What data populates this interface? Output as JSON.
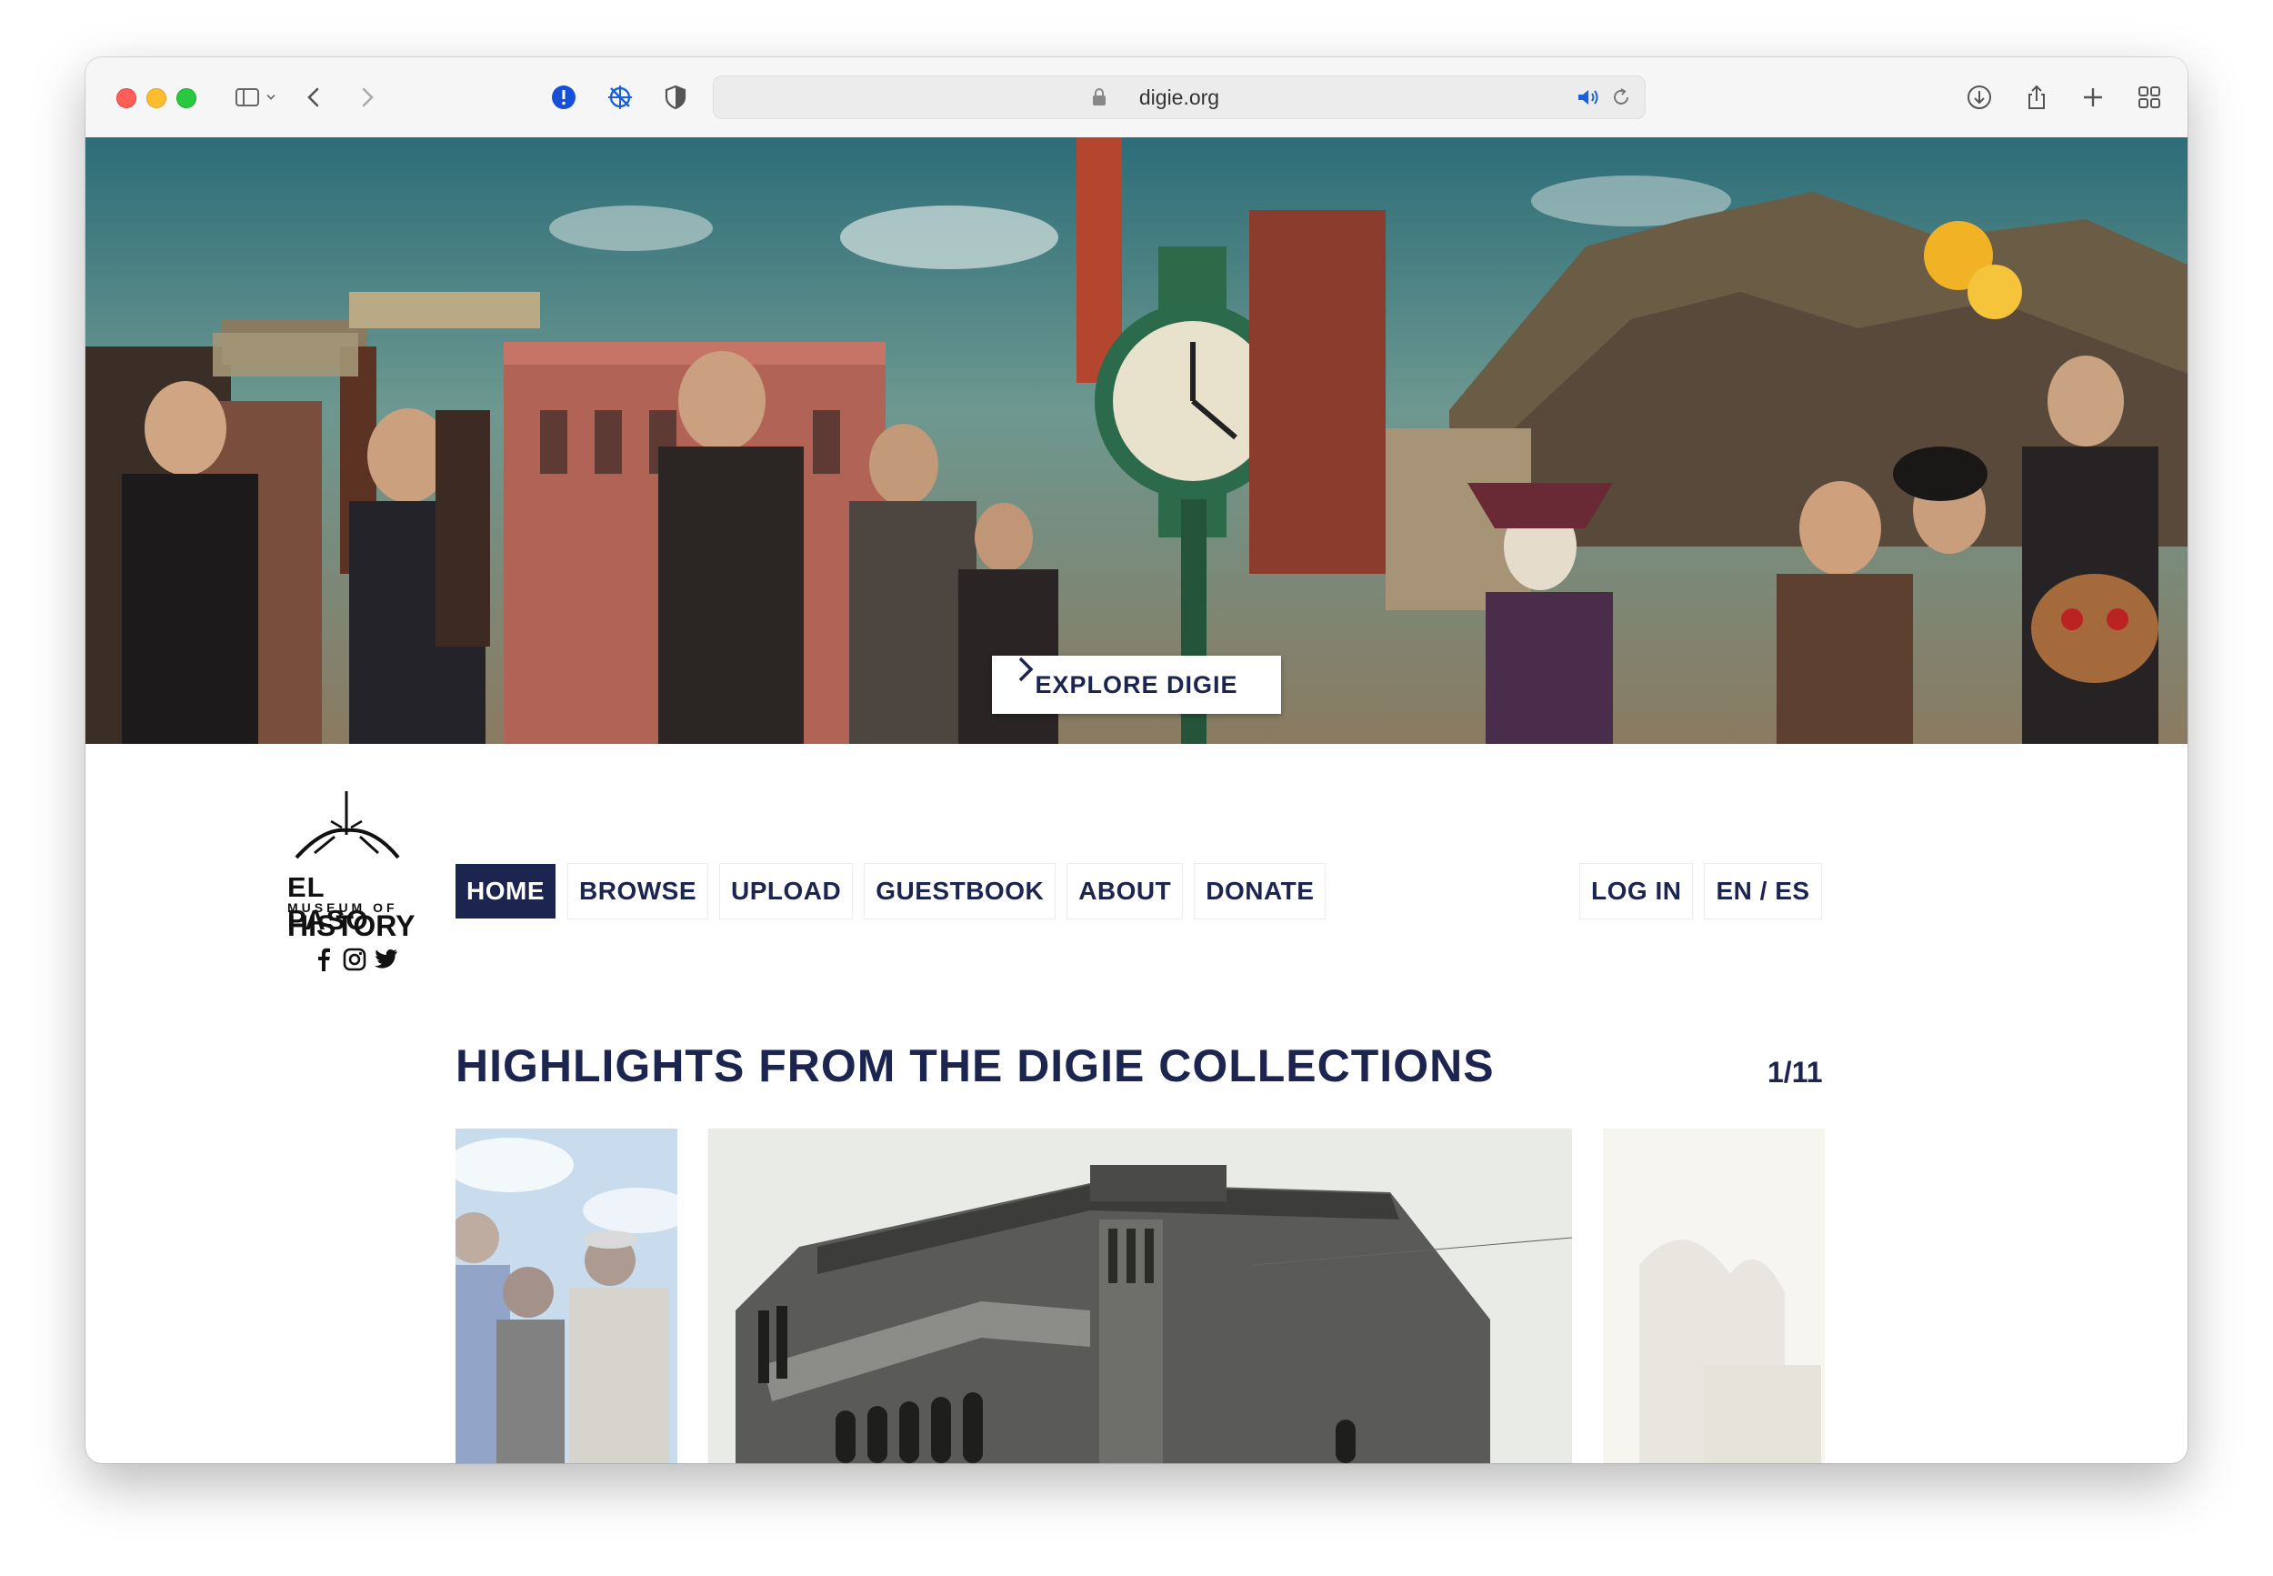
{
  "browser": {
    "url": "digie.org",
    "icons": [
      "sidebar-icon",
      "chevron-down-icon",
      "back-icon",
      "forward-icon",
      "privacy-report-icon",
      "extension-icon",
      "shield-icon",
      "lock-icon",
      "speaker-icon",
      "reload-icon",
      "download-icon",
      "share-icon",
      "new-tab-icon",
      "tab-overview-icon"
    ]
  },
  "hero": {
    "cta_label": "EXPLORE DIGIE"
  },
  "logo": {
    "line1": "EL PASO",
    "line2": "MUSEUM OF",
    "line3": "HISTORY"
  },
  "social": [
    "facebook-icon",
    "instagram-icon",
    "twitter-icon"
  ],
  "nav": {
    "items": [
      {
        "label": "HOME",
        "active": true
      },
      {
        "label": "BROWSE",
        "active": false
      },
      {
        "label": "UPLOAD",
        "active": false
      },
      {
        "label": "GUESTBOOK",
        "active": false
      },
      {
        "label": "ABOUT",
        "active": false
      },
      {
        "label": "DONATE",
        "active": false
      }
    ],
    "right": [
      {
        "label": "LOG IN"
      },
      {
        "label": "EN / ES"
      }
    ]
  },
  "highlights": {
    "heading": "HIGHLIGHTS FROM THE DIGIE COLLECTIONS",
    "counter": "1/11"
  },
  "colors": {
    "brand_navy": "#1b2550",
    "toolbar_bg": "#f6f6f6"
  }
}
